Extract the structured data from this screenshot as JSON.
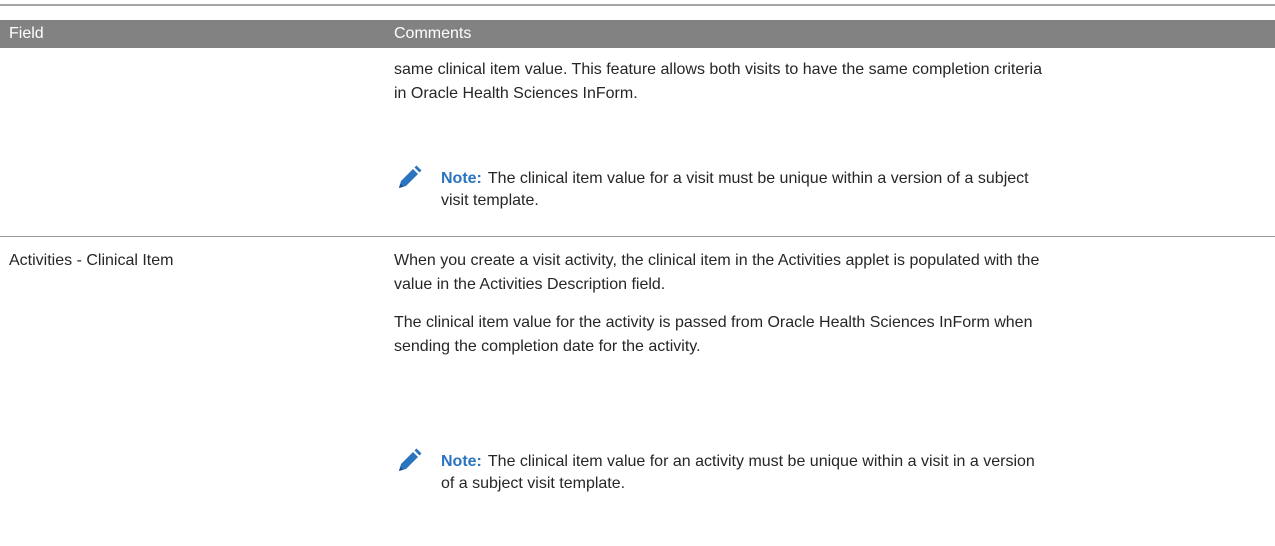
{
  "table": {
    "headers": {
      "field": "Field",
      "comments": "Comments"
    },
    "row1": {
      "comment_line1": "same clinical item value. This feature allows both visits to have the same completion criteria",
      "comment_line2": "in Oracle Health Sciences InForm.",
      "note_label": "Note:",
      "note_line1": "The clinical item value for a visit must be unique within a version of a subject",
      "note_line2": "visit template."
    },
    "row2": {
      "field": "Activities - Clinical Item",
      "para1_line1": "When you create a visit activity, the clinical item in the Activities applet is populated with the",
      "para1_line2": "value in the Activities Description field.",
      "para2_line1": "The clinical item value for the activity is passed from Oracle Health Sciences InForm when",
      "para2_line2": "sending the completion date for the activity.",
      "note_label": "Note:",
      "note_line1": "The clinical item value for an activity must be unique within a visit in a version",
      "note_line2": "of a subject visit template."
    }
  },
  "colors": {
    "header_bg": "#828282",
    "note_label": "#2a74c0",
    "pencil_icon": "#2a74c0"
  },
  "icons": {
    "note": "pencil-icon"
  }
}
